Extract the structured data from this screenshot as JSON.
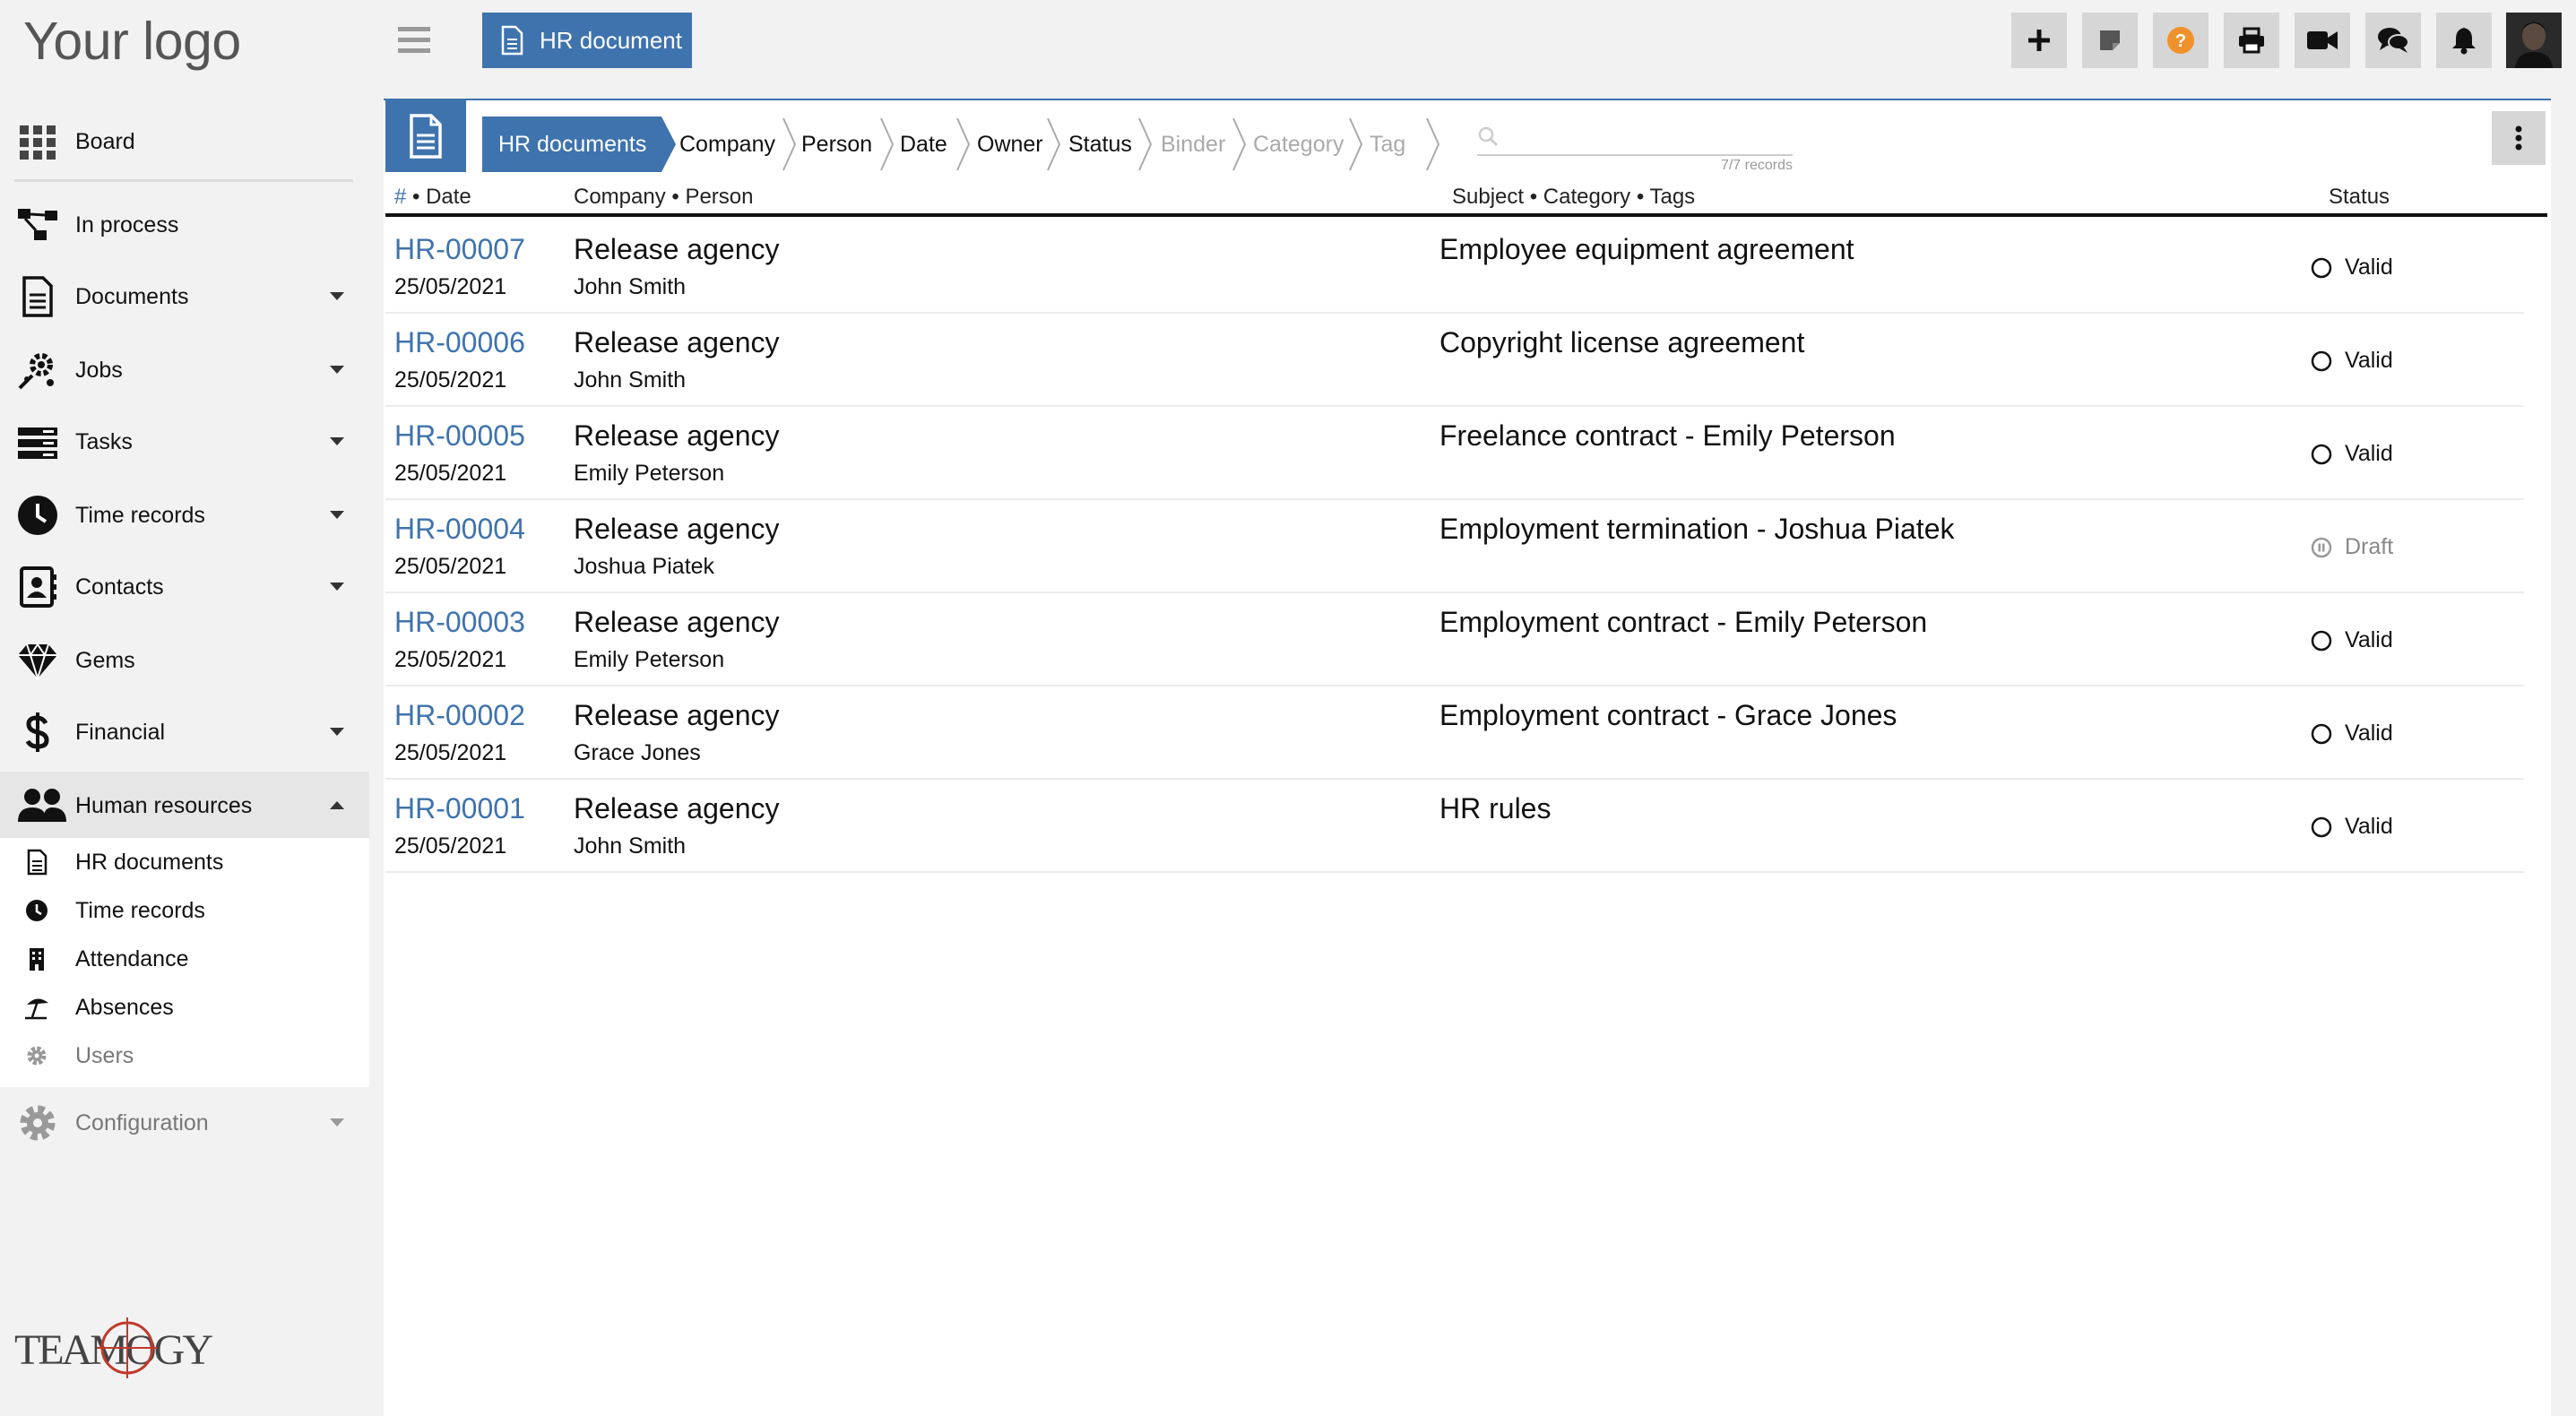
{
  "logo": "Your logo",
  "sidebar": {
    "items": [
      {
        "label": "Board",
        "icon": "grid-icon"
      },
      {
        "label": "In process",
        "icon": "workflow-icon"
      },
      {
        "label": "Documents",
        "icon": "document-icon"
      },
      {
        "label": "Jobs",
        "icon": "jobs-icon"
      },
      {
        "label": "Tasks",
        "icon": "tasks-icon"
      },
      {
        "label": "Time records",
        "icon": "clock-icon"
      },
      {
        "label": "Contacts",
        "icon": "contacts-icon"
      },
      {
        "label": "Gems",
        "icon": "gem-icon"
      },
      {
        "label": "Financial",
        "icon": "dollar-icon"
      },
      {
        "label": "Human resources",
        "icon": "people-icon"
      },
      {
        "label": "Configuration",
        "icon": "gear-icon"
      }
    ],
    "hr_sub": [
      {
        "label": "HR documents",
        "icon": "document-icon"
      },
      {
        "label": "Time records",
        "icon": "clock-icon"
      },
      {
        "label": "Attendance",
        "icon": "building-icon"
      },
      {
        "label": "Absences",
        "icon": "beach-umbrella-icon"
      },
      {
        "label": "Users",
        "icon": "gear-icon"
      }
    ],
    "brand": "TEAMOGY"
  },
  "topbar": {
    "doc_button": "HR document",
    "accent": "#3f73ad",
    "help_color": "#f0922b"
  },
  "breadcrumb": [
    "HR documents",
    "Company",
    "Person",
    "Date",
    "Owner",
    "Status",
    "Binder",
    "Category",
    "Tag"
  ],
  "search": {
    "records": "7/7 records"
  },
  "table": {
    "headers": {
      "hash": "#",
      "date": "• Date",
      "company_person": "Company • Person",
      "subject": "Subject • Category • Tags",
      "status": "Status"
    },
    "rows": [
      {
        "id": "HR-00007",
        "date": "25/05/2021",
        "company": "Release agency",
        "person": "John Smith",
        "subject": "Employee equipment agreement",
        "status": "Valid"
      },
      {
        "id": "HR-00006",
        "date": "25/05/2021",
        "company": "Release agency",
        "person": "John Smith",
        "subject": "Copyright license agreement",
        "status": "Valid"
      },
      {
        "id": "HR-00005",
        "date": "25/05/2021",
        "company": "Release agency",
        "person": "Emily Peterson",
        "subject": "Freelance contract - Emily Peterson",
        "status": "Valid"
      },
      {
        "id": "HR-00004",
        "date": "25/05/2021",
        "company": "Release agency",
        "person": "Joshua Piatek",
        "subject": "Employment termination - Joshua Piatek",
        "status": "Draft"
      },
      {
        "id": "HR-00003",
        "date": "25/05/2021",
        "company": "Release agency",
        "person": "Emily Peterson",
        "subject": "Employment contract - Emily Peterson",
        "status": "Valid"
      },
      {
        "id": "HR-00002",
        "date": "25/05/2021",
        "company": "Release agency",
        "person": "Grace Jones",
        "subject": "Employment contract - Grace Jones",
        "status": "Valid"
      },
      {
        "id": "HR-00001",
        "date": "25/05/2021",
        "company": "Release agency",
        "person": "John Smith",
        "subject": "HR rules",
        "status": "Valid"
      }
    ]
  }
}
